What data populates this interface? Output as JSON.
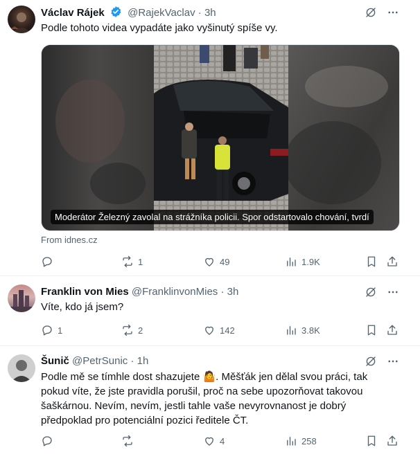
{
  "posts": [
    {
      "name": "Václav Rájek",
      "handle": "@RajekVaclav",
      "time": "3h",
      "text": "Podle tohoto videa vypadáte jako vyšinutý spíše vy.",
      "media_caption": "Moderátor Železný zavolal na strážníka policii. Spor odstartovalo chování, tvrdí",
      "source": "From idnes.cz",
      "replies": "",
      "reposts": "1",
      "likes": "49",
      "views": "1.9K"
    },
    {
      "name": "Franklin von Mies",
      "handle": "@FranklinvonMies",
      "time": "3h",
      "text": "Víte, kdo já jsem?",
      "replies": "1",
      "reposts": "2",
      "likes": "142",
      "views": "3.8K"
    },
    {
      "name": "Šunič",
      "handle": "@PetrSunic",
      "time": "1h",
      "text": "Podle mě se tímhle dost shazujete 🤷. Měšťák jen dělal svou práci, tak pokud víte, že jste pravidla porušil, proč na sebe upozorňovat takovou šaškárnou. Nevím, nevím, jestli tahle vaše nevyrovnanost je dobrý předpoklad pro potenciální pozici ředitele ČT.",
      "replies": "",
      "reposts": "",
      "likes": "4",
      "views": "258"
    }
  ],
  "separator": "·",
  "icons": [
    "grok-icon",
    "more-icon",
    "reply-icon",
    "repost-icon",
    "like-icon",
    "views-icon",
    "bookmark-icon",
    "share-icon",
    "verified-badge-icon"
  ],
  "colors": {
    "text": "#0f1419",
    "secondary": "#536471",
    "verified": "#1d9bf0",
    "border": "#eff3f4"
  }
}
